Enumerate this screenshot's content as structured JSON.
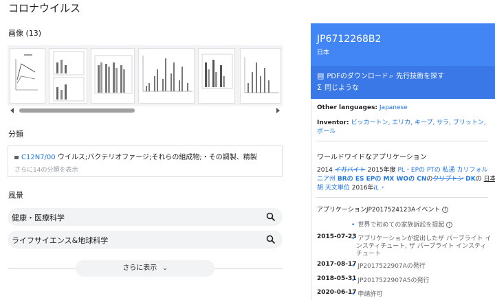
{
  "page": {
    "title": "コロナウイルス"
  },
  "images": {
    "heading": "画像 (13)"
  },
  "classifications": {
    "heading": "分類",
    "code": "C12N7/00",
    "description": "ウイルス;バクテリオファージ;それらの組成物;・その調製、精製",
    "more": "さらに14の分類を表示"
  },
  "concepts": {
    "heading": "風景",
    "items": [
      {
        "label": "健康・医療科学"
      },
      {
        "label": "ライフサイエンス&地球科学"
      }
    ],
    "show_more": "さらに表示"
  },
  "patent": {
    "number": "JP6712268B2",
    "country": "日本",
    "actions": {
      "pdf": "PDFのダウンロード",
      "prior_art": "先行技術を探す",
      "similar": "同じような"
    },
    "other_languages_label": "Other languages:",
    "other_languages_value": "Japanese",
    "inventor_label": "Inventor:",
    "inventor_line1": "ビッカートン, エリカ, キープ, サラ, ブリットン,",
    "inventor_line2": "ポール"
  },
  "worldwide": {
    "heading": "ワールドワイドなアプリケーション",
    "l1_a": "2014",
    "l1_b": "イガバイト",
    "l1_c": "2015年度",
    "l1_d": "PL・EPの PTの 私通 カリフォル",
    "l2_a": "ニア州",
    "l2_b": "BRの ES EP",
    "l2_c": "の MX WO",
    "l2_d": "の CN",
    "l2_e": "の",
    "l2_f": "クリプトン",
    "l2_g": "DK",
    "l2_h": "の",
    "l2_i": "日本語",
    "l3_a": "胡 天文単位",
    "l3_b": "2016年",
    "l3_c": "IL・"
  },
  "events": {
    "heading": "アプリケーションJP2017524123Aイベント",
    "items": [
      {
        "date": "",
        "text": "世界で初めての家族訴訟を提起"
      },
      {
        "date": "2015-07-23",
        "text": "アプリケーションが提出したザ パーブライト イ",
        "text2": "ンスティチュート, ザ パーブライト インスティ",
        "text3": "チュート"
      },
      {
        "date": "2017-08-17",
        "text": "JP2017522907Aの発行"
      },
      {
        "date": "2018-05-31",
        "text": "JP2017522907A5の発行"
      },
      {
        "date": "2020-06-17",
        "text": "申請許可"
      }
    ]
  }
}
